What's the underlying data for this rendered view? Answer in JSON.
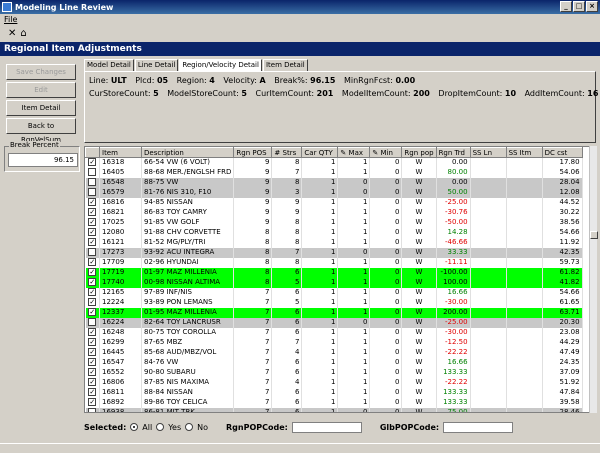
{
  "window": {
    "title": "Modeling Line Review"
  },
  "menu": {
    "items": [
      "File"
    ]
  },
  "toolbar": {
    "icons": [
      "close-icon",
      "home-icon"
    ],
    "close_glyph": "✕",
    "home_glyph": "⌂"
  },
  "section": {
    "title": "Regional Item Adjustments"
  },
  "sidebar": {
    "buttons": [
      {
        "label": "Save Changes",
        "enabled": false
      },
      {
        "label": "Edit",
        "enabled": false
      },
      {
        "label": "Item Detail",
        "enabled": true
      },
      {
        "label": "Back to RgnVelSum",
        "enabled": true
      }
    ],
    "break_percent_label": "Break Percent",
    "break_percent_value": "96.15"
  },
  "tabs": [
    "Model Detail",
    "Line Detail",
    "Region/Velocity Detail",
    "Item Detail"
  ],
  "active_tab": 2,
  "info": {
    "line_label": "Line:",
    "line": "ULT",
    "plcd_label": "Plcd:",
    "plcd": "05",
    "region_label": "Region:",
    "region": "4",
    "velocity_label": "Velocity:",
    "velocity": "A",
    "break_label": "Break%:",
    "break": "96.15",
    "minrgn_label": "MinRgnFcst:",
    "minrgn": "0.00",
    "curstore_label": "CurStoreCount:",
    "curstore": "5",
    "modelstore_label": "ModelStoreCount:",
    "modelstore": "5",
    "curitem_label": "CurItemCount:",
    "curitem": "201",
    "modelitem_label": "ModelItemCount:",
    "modelitem": "200",
    "drop_label": "DropItemCount:",
    "drop": "10",
    "add_label": "AddItemCount:",
    "add": "16"
  },
  "grid": {
    "columns": [
      "Item",
      "Description",
      "Rgn POS",
      "# Strs",
      "Car QTY",
      "Max",
      "Min",
      "Rgn pop",
      "Rgn Trd",
      "SS Ln",
      "SS Itm",
      "DC cst"
    ],
    "rows": [
      {
        "checked": true,
        "item": "16318",
        "desc": "66-54 VW (6 VOLT)",
        "pos": "9",
        "strs": "8",
        "car": "1",
        "max": "1",
        "min": "0",
        "pop": "W",
        "trd": "0.00",
        "dc": "17.80",
        "hl": "white"
      },
      {
        "checked": false,
        "item": "16405",
        "desc": "88-68 MER./ENGLSH FRD",
        "pos": "9",
        "strs": "7",
        "car": "1",
        "max": "1",
        "min": "0",
        "pop": "W",
        "trd": "80.00",
        "dc": "54.06",
        "hl": "white"
      },
      {
        "checked": false,
        "item": "16548",
        "desc": "88-75 VW",
        "pos": "9",
        "strs": "8",
        "car": "1",
        "max": "0",
        "min": "0",
        "pop": "W",
        "trd": "0.00",
        "dc": "28.04",
        "hl": "gray"
      },
      {
        "checked": false,
        "item": "16579",
        "desc": "81-76 NIS 310, F10",
        "pos": "9",
        "strs": "3",
        "car": "1",
        "max": "0",
        "min": "0",
        "pop": "W",
        "trd": "50.00",
        "dc": "12.08",
        "hl": "gray"
      },
      {
        "checked": true,
        "item": "16816",
        "desc": "94-85 NISSAN",
        "pos": "9",
        "strs": "9",
        "car": "1",
        "max": "1",
        "min": "0",
        "pop": "W",
        "trd": "-25.00",
        "dc": "44.52",
        "hl": "white"
      },
      {
        "checked": true,
        "item": "16821",
        "desc": "86-83 TOY CAMRY",
        "pos": "9",
        "strs": "9",
        "car": "1",
        "max": "1",
        "min": "0",
        "pop": "W",
        "trd": "-30.76",
        "dc": "30.22",
        "hl": "white"
      },
      {
        "checked": true,
        "item": "17025",
        "desc": "91-85 VW GOLF",
        "pos": "9",
        "strs": "8",
        "car": "1",
        "max": "1",
        "min": "0",
        "pop": "W",
        "trd": "-50.00",
        "dc": "38.56",
        "hl": "white"
      },
      {
        "checked": true,
        "item": "12080",
        "desc": "91-88 CHV CORVETTE",
        "pos": "8",
        "strs": "8",
        "car": "1",
        "max": "1",
        "min": "0",
        "pop": "W",
        "trd": "14.28",
        "dc": "54.66",
        "hl": "white"
      },
      {
        "checked": true,
        "item": "16121",
        "desc": "81-52 MG/PLY/TRI",
        "pos": "8",
        "strs": "8",
        "car": "1",
        "max": "1",
        "min": "0",
        "pop": "W",
        "trd": "-46.66",
        "dc": "11.92",
        "hl": "white"
      },
      {
        "checked": false,
        "item": "17273",
        "desc": "93-92 ACU INTEGRA",
        "pos": "8",
        "strs": "7",
        "car": "1",
        "max": "0",
        "min": "0",
        "pop": "W",
        "trd": "33.33",
        "dc": "42.35",
        "hl": "gray"
      },
      {
        "checked": true,
        "item": "17709",
        "desc": "02-96 HYUNDAI",
        "pos": "8",
        "strs": "8",
        "car": "1",
        "max": "1",
        "min": "0",
        "pop": "W",
        "trd": "-11.11",
        "dc": "59.73",
        "hl": "white"
      },
      {
        "checked": true,
        "item": "17719",
        "desc": "01-97 MAZ MILLENIA",
        "pos": "8",
        "strs": "6",
        "car": "1",
        "max": "1",
        "min": "0",
        "pop": "W",
        "trd": "-100.00",
        "dc": "61.82",
        "hl": "green"
      },
      {
        "checked": true,
        "item": "17740",
        "desc": "00-98 NISSAN ALTIMA",
        "pos": "8",
        "strs": "5",
        "car": "1",
        "max": "1",
        "min": "0",
        "pop": "W",
        "trd": "100.00",
        "dc": "41.82",
        "hl": "green"
      },
      {
        "checked": true,
        "item": "12165",
        "desc": "97-89 INF/NIS",
        "pos": "7",
        "strs": "6",
        "car": "1",
        "max": "1",
        "min": "0",
        "pop": "W",
        "trd": "16.66",
        "dc": "54.66",
        "hl": "white"
      },
      {
        "checked": true,
        "item": "12224",
        "desc": "93-89 PON LEMANS",
        "pos": "7",
        "strs": "5",
        "car": "1",
        "max": "1",
        "min": "0",
        "pop": "W",
        "trd": "-30.00",
        "dc": "61.65",
        "hl": "white"
      },
      {
        "checked": true,
        "item": "12337",
        "desc": "01-95 MAZ MILLENIA",
        "pos": "7",
        "strs": "6",
        "car": "1",
        "max": "1",
        "min": "0",
        "pop": "W",
        "trd": "200.00",
        "dc": "63.71",
        "hl": "green"
      },
      {
        "checked": false,
        "item": "16224",
        "desc": "82-64 TOY LANCRUSR",
        "pos": "7",
        "strs": "6",
        "car": "1",
        "max": "0",
        "min": "0",
        "pop": "W",
        "trd": "-25.00",
        "dc": "20.30",
        "hl": "gray"
      },
      {
        "checked": true,
        "item": "16248",
        "desc": "80-75 TOY COROLLA",
        "pos": "7",
        "strs": "6",
        "car": "1",
        "max": "1",
        "min": "0",
        "pop": "W",
        "trd": "-30.00",
        "dc": "23.08",
        "hl": "white"
      },
      {
        "checked": true,
        "item": "16299",
        "desc": "87-65 MBZ",
        "pos": "7",
        "strs": "7",
        "car": "1",
        "max": "1",
        "min": "0",
        "pop": "W",
        "trd": "-12.50",
        "dc": "44.29",
        "hl": "white"
      },
      {
        "checked": true,
        "item": "16445",
        "desc": "85-68 AUD/MBZ/VOL",
        "pos": "7",
        "strs": "4",
        "car": "1",
        "max": "1",
        "min": "0",
        "pop": "W",
        "trd": "-22.22",
        "dc": "47.49",
        "hl": "white"
      },
      {
        "checked": true,
        "item": "16547",
        "desc": "84-76 VW",
        "pos": "7",
        "strs": "6",
        "car": "1",
        "max": "1",
        "min": "0",
        "pop": "W",
        "trd": "16.66",
        "dc": "24.35",
        "hl": "white"
      },
      {
        "checked": true,
        "item": "16552",
        "desc": "90-80 SUBARU",
        "pos": "7",
        "strs": "6",
        "car": "1",
        "max": "1",
        "min": "0",
        "pop": "W",
        "trd": "133.33",
        "dc": "37.09",
        "hl": "white"
      },
      {
        "checked": true,
        "item": "16806",
        "desc": "87-85 NIS MAXIMA",
        "pos": "7",
        "strs": "4",
        "car": "1",
        "max": "1",
        "min": "0",
        "pop": "W",
        "trd": "-22.22",
        "dc": "51.92",
        "hl": "white"
      },
      {
        "checked": true,
        "item": "16811",
        "desc": "88-84 NISSAN",
        "pos": "7",
        "strs": "6",
        "car": "1",
        "max": "1",
        "min": "0",
        "pop": "W",
        "trd": "133.33",
        "dc": "47.84",
        "hl": "white"
      },
      {
        "checked": true,
        "item": "16892",
        "desc": "89-86 TOY CELICA",
        "pos": "7",
        "strs": "6",
        "car": "1",
        "max": "1",
        "min": "0",
        "pop": "W",
        "trd": "133.33",
        "dc": "39.58",
        "hl": "white"
      },
      {
        "checked": false,
        "item": "16938",
        "desc": "86-81 MIT TRK",
        "pos": "7",
        "strs": "6",
        "car": "1",
        "max": "0",
        "min": "0",
        "pop": "W",
        "trd": "75.00",
        "dc": "28.46",
        "hl": "gray"
      }
    ]
  },
  "footer": {
    "selected_label": "Selected:",
    "options": [
      "All",
      "Yes",
      "No"
    ],
    "selected_option": "All",
    "rgnpop_label": "RgnPOPCode:",
    "glbpop_label": "GlbPOPCode:"
  },
  "colors": {
    "title_bar": "#0a246a",
    "section_bar": "#0a246a",
    "row_green": "#00ff00",
    "row_gray": "#c8c8c8",
    "positive": "#008000",
    "negative": "#e00000"
  }
}
